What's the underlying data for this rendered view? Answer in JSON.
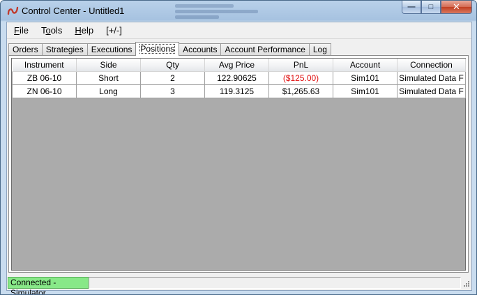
{
  "window": {
    "title": "Control Center - Untitled1"
  },
  "menu": [
    {
      "pre": "",
      "u": "F",
      "post": "ile"
    },
    {
      "pre": "T",
      "u": "o",
      "post": "ols"
    },
    {
      "pre": "",
      "u": "H",
      "post": "elp"
    },
    {
      "pre": "",
      "u": "",
      "post": "[+/-]"
    }
  ],
  "tabs": [
    "Orders",
    "Strategies",
    "Executions",
    "Positions",
    "Accounts",
    "Account Performance",
    "Log"
  ],
  "active_tab": "Positions",
  "grid": {
    "columns": [
      "Instrument",
      "Side",
      "Qty",
      "Avg Price",
      "PnL",
      "Account",
      "Connection"
    ],
    "rows": [
      [
        "ZB 06-10",
        "Short",
        "2",
        "122.90625",
        "($125.00)",
        "Sim101",
        "Simulated Data F"
      ],
      [
        "ZN 06-10",
        "Long",
        "3",
        "119.3125",
        "$1,265.63",
        "Sim101",
        "Simulated Data F"
      ]
    ]
  },
  "status": {
    "connection": "Connected - Simulator"
  },
  "colors": {
    "negative_pnl": "#e01010",
    "connected_bg": "#88e888",
    "grid_bg": "#ababab"
  },
  "icons": {
    "app": "ninja-logo-icon",
    "min": "minimize-icon",
    "max": "maximize-icon",
    "close": "close-icon"
  }
}
